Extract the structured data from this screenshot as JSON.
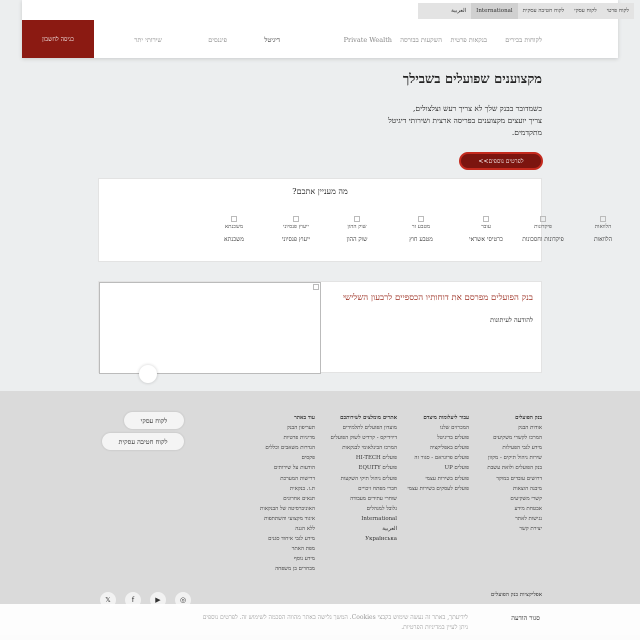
{
  "header": {
    "topstrip": [
      "לקוח פרטי",
      "לקוח עסקי",
      "לקוח חטיבה עסקית",
      "International",
      "العربية"
    ],
    "cta_label": "כניסה לחשבון",
    "nav": [
      "לקוחות בכירים",
      "בנקאות פרטית",
      "השקעות בבורסה",
      "Private Wealth",
      "דיגיטל",
      "פיננסים",
      "שירותי יתר"
    ]
  },
  "hero": {
    "title": "מקצוענים שפועלים בשבילך",
    "line1": "כשמדובר בבנק שלך לא צריך רעש וצלצולים,",
    "line2": "צריך יועצים מקצוענים בפריסה ארצית ושירותי דיגיטל",
    "line3": "מתקדמים.",
    "more_label": "לפרטים נוספים>>"
  },
  "interests": {
    "title": "מה מעניין אתכם?",
    "items": [
      {
        "icon": "הלוואות",
        "label": "הלוואות"
      },
      {
        "icon": "פיקדונות",
        "label": "פיקדונות וחסכונות"
      },
      {
        "icon": "עובר",
        "label": "כרטיסי אשראי"
      },
      {
        "icon": "מטבע זר",
        "label": "מטבע חוץ"
      },
      {
        "icon": "שוק ההון",
        "label": "שוק ההון"
      },
      {
        "icon": "ייעוץ פנסיוני",
        "label": "ייעוץ פנסיוני"
      },
      {
        "icon": "משכנתא",
        "label": "משכנתא"
      }
    ]
  },
  "promo": {
    "title": "בנק הפועלים מפרסם את דוחותיו הכספיים לרבעון השלישי",
    "link": "להודעה לעיתונות"
  },
  "footer": {
    "col1": {
      "heading": "בנק הפועלים",
      "items": [
        "אודות הבנק",
        "המרכז לקשרי משקיעים",
        "מידע לגבי הפעילות",
        "שירות ניהול תיקים - מקוון",
        "בנק הפועלים ולואת עשבת",
        "דרושים עובדים במוקד",
        "מיבנה הוצאות",
        "קשרי משקיעים",
        "אבטחת מידע",
        "נגישות לאתר",
        "יצירת קשר"
      ]
    },
    "col2": {
      "heading": "עבור ליעלומות מיצדם",
      "items": [
        "המכרזים שלנו",
        "פועלים בדיגיטל",
        "פועלים באפליקציה",
        "פועלים פרוגראם - סגור זה",
        "פועלים UP",
        "פועלים בשירות עצמי",
        "פועלים לעסקים בשירות עצמי"
      ]
    },
    "col3": {
      "heading": "אתרים מומלצים לשירותכם",
      "items": [
        "מועדון הפועלים לתלמידים",
        "דיוידיקס - קרדיט לשוק הפועלים",
        "המרכז הבינלאומי לבנקאות",
        "פועלים HI-TECH",
        "פועלים EQUITY",
        "פועלים ניהול תיקי השקעות",
        "חברי מפתח זיכויים",
        "שוחרי עתידים מעבודה",
        "גלובל למנהלים",
        "International",
        "العربية",
        "Українська"
      ]
    },
    "col4": {
      "heading": "עוד באתר",
      "items": [
        "תעריפון הבנק",
        "מדיניות פרטיות",
        "הגדרות משאבים וכללים",
        "פקסים",
        "הודעות על שירותים",
        "דרישות המערכת",
        "ת.ז. בנקאית",
        "תנאים אחרונים",
        "האוניברסיטה של הבנקאות",
        "איגוד מקצועי והשתתפות",
        "ללא הגנה",
        "מידע לגבי איחוד סגנים",
        "מפת האתר",
        "מידע נוסף",
        "מבחרים בן משפחה"
      ]
    },
    "btn_business": "לקוח עסקי",
    "btn_corporate": "לקוח חטיבה עסקית",
    "apps_label": "אפליקציות בנק הפועלים",
    "socials": [
      "instagram-icon",
      "youtube-icon",
      "facebook-icon",
      "twitter-icon"
    ]
  },
  "cookie": {
    "text": "לידיעתך, באתר זה נעשה שימוש בקבצי Cookies. המשך גלישה באתר מהווה הסכמה לשימוש זה. לפרטים נוספים ניתן לעיין במדיניות הפרטיות.",
    "close_label": "סגור הודעה"
  }
}
